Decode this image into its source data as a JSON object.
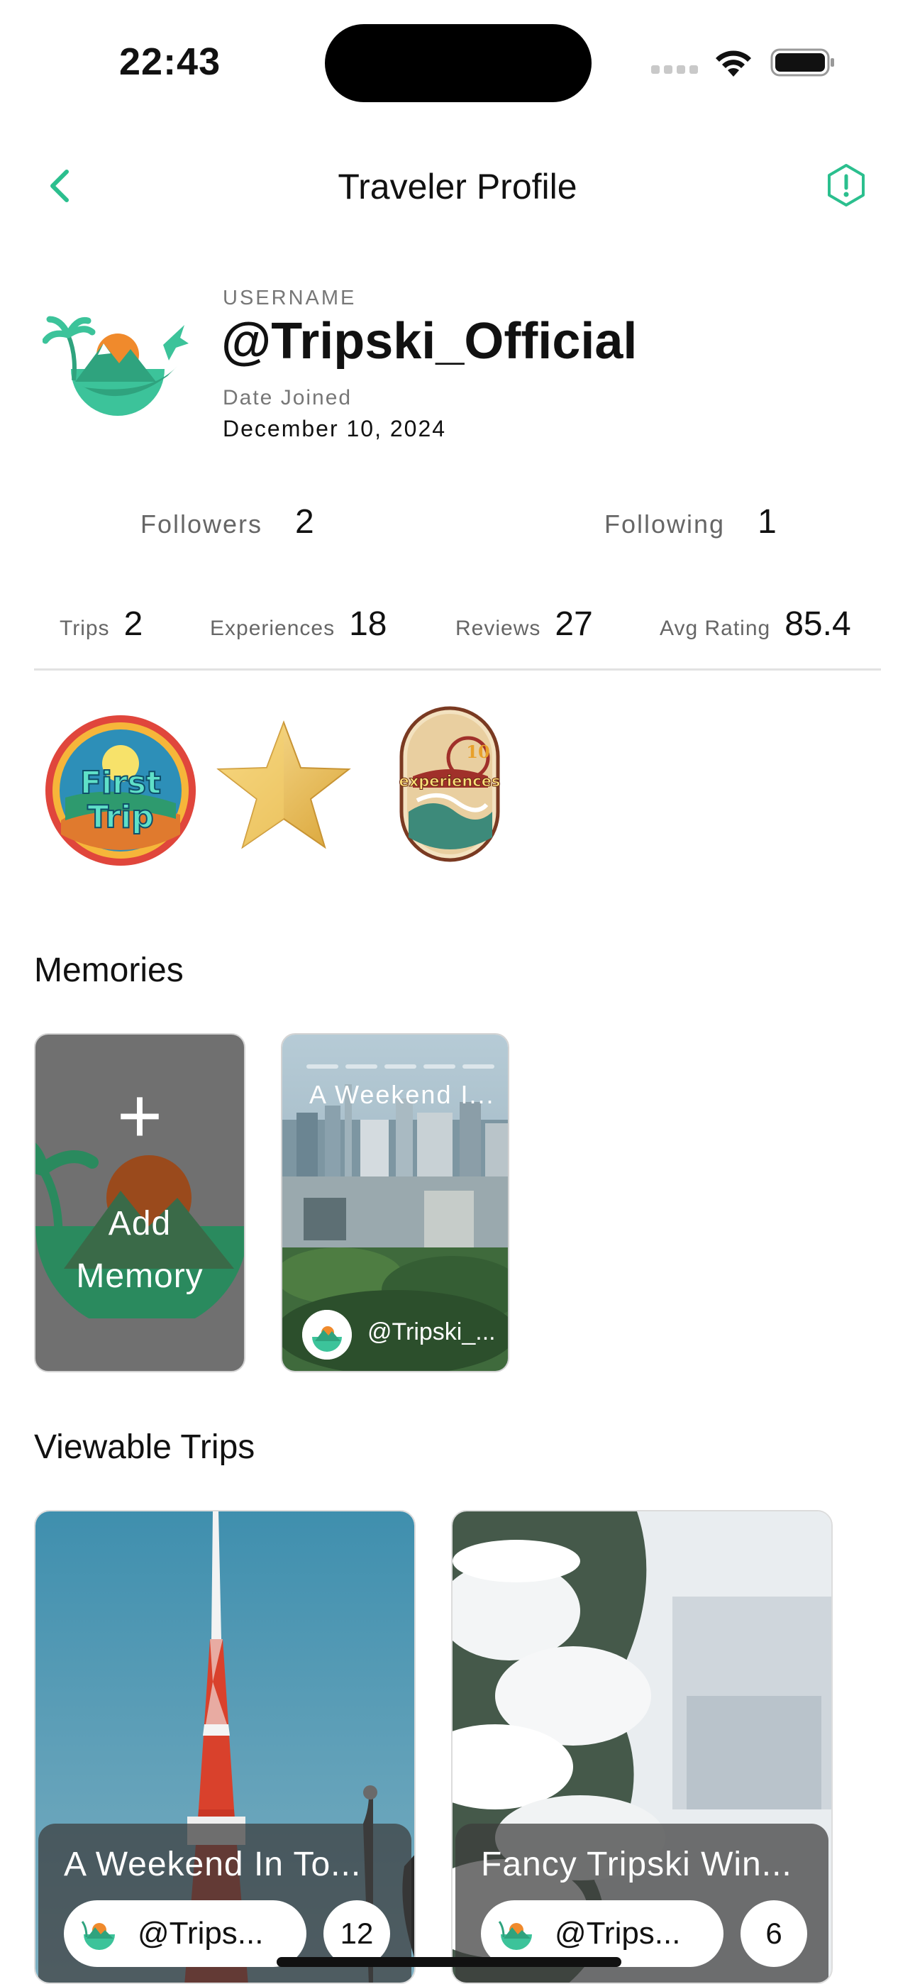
{
  "status_bar": {
    "time": "22:43"
  },
  "nav": {
    "title": "Traveler Profile",
    "back_icon": "chevron-left-icon",
    "report_icon": "alert-hexagon-icon"
  },
  "profile": {
    "username_label": "USERNAME",
    "username": "@Tripski_Official",
    "date_joined_label": "Date Joined",
    "date_joined": "December 10, 2024"
  },
  "follow": {
    "followers_label": "Followers",
    "followers": "2",
    "following_label": "Following",
    "following": "1"
  },
  "stats": {
    "trips_label": "Trips",
    "trips": "2",
    "experiences_label": "Experiences",
    "experiences": "18",
    "reviews_label": "Reviews",
    "reviews": "27",
    "avg_rating_label": "Avg Rating",
    "avg_rating": "85.4"
  },
  "badges": [
    {
      "name": "first-trip-badge",
      "text": "First Trip"
    },
    {
      "name": "star-badge"
    },
    {
      "name": "ten-experiences-badge",
      "text": "10 experiences"
    }
  ],
  "memories": {
    "title": "Memories",
    "add_label": "Add\nMemory",
    "items": [
      {
        "title": "A Weekend I...",
        "user": "@Tripski_..."
      }
    ]
  },
  "trips": {
    "title": "Viewable Trips",
    "items": [
      {
        "title": "A Weekend In To...",
        "user": "@Trips...",
        "count": "12"
      },
      {
        "title": "Fancy Tripski Win...",
        "user": "@Trips...",
        "count": "6"
      }
    ]
  },
  "colors": {
    "accent": "#2bbf8e",
    "brand_green": "#3cc39a",
    "brand_orange": "#f08a2c"
  }
}
